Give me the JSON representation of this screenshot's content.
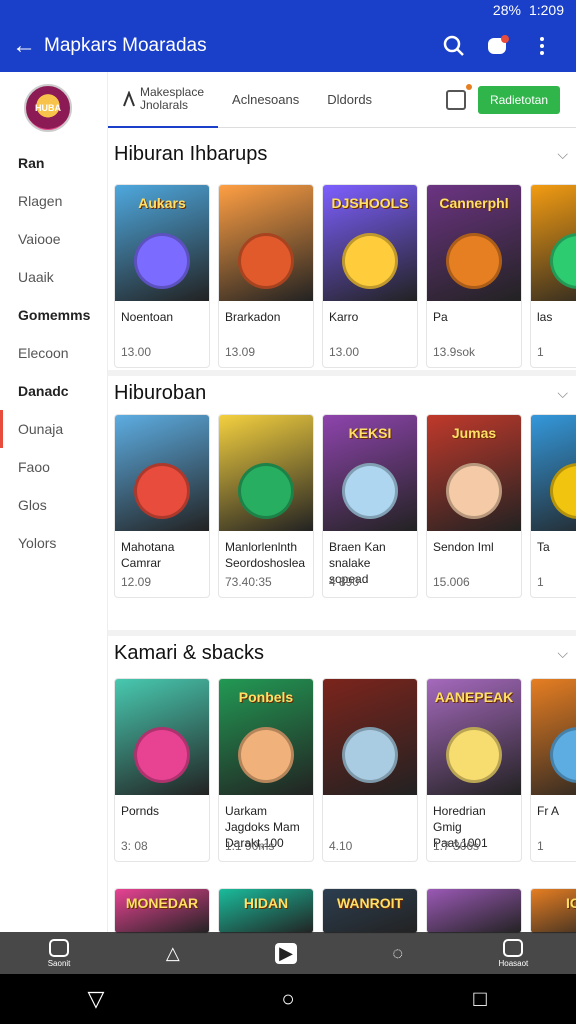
{
  "status": {
    "battery": "28%",
    "time": "1:209"
  },
  "appbar": {
    "title": "Mapkars Moaradas"
  },
  "sidebar": {
    "logo_text": "HUBA",
    "items": [
      {
        "label": "Ran",
        "bold": true
      },
      {
        "label": "Rlagen",
        "bold": false
      },
      {
        "label": "Vaiooe",
        "bold": false
      },
      {
        "label": "Uaaik",
        "bold": false
      },
      {
        "label": "Gomemms",
        "bold": true
      },
      {
        "label": "Elecoon",
        "bold": false
      },
      {
        "label": "Danadc",
        "bold": true
      },
      {
        "label": "Ounaja",
        "bold": false,
        "active": true
      },
      {
        "label": "Faoo",
        "bold": false
      },
      {
        "label": "Glos",
        "bold": false
      },
      {
        "label": "Yolors",
        "bold": false
      }
    ]
  },
  "tabs": {
    "main_line1": "Makesplace",
    "main_line2": "Jnolarals",
    "tab2": "Aclnesoans",
    "tab3": "Dldords",
    "install": "Radietotan"
  },
  "sections": [
    {
      "title": "Hiburan Ihbarups",
      "cards": [
        {
          "thumb": "Aukars",
          "name": "Noentoan",
          "price": "13.00",
          "bg": "#4ea8de",
          "face": "#7b6cff"
        },
        {
          "thumb": "",
          "name": "Brarkadon",
          "price": "13.09",
          "bg": "#ff9f43",
          "face": "#e05a2b"
        },
        {
          "thumb": "DJSHOOLS",
          "name": "Karro",
          "price": "13.00",
          "bg": "#7d5fff",
          "face": "#ffcd3c"
        },
        {
          "thumb": "Cannerphl",
          "name": "Pa",
          "price": "13.9sok",
          "bg": "#6c3483",
          "face": "#e67e22"
        },
        {
          "thumb": "",
          "name": "las",
          "price": "1",
          "bg": "#f39c12",
          "face": "#2ecc71"
        }
      ]
    },
    {
      "title": "Hiburoban",
      "cards": [
        {
          "thumb": "",
          "name": "Mahotana Camrar",
          "price": "12.09",
          "bg": "#5dade2",
          "face": "#e74c3c"
        },
        {
          "thumb": "",
          "name": "Manlorlenlnth Seordoshoslea",
          "price": "73.40:35",
          "bg": "#f4d03f",
          "face": "#27ae60"
        },
        {
          "thumb": "KEKSI",
          "name": "Braen Kan snalake sopead",
          "price": "4 890",
          "bg": "#8e44ad",
          "face": "#aed6f1"
        },
        {
          "thumb": "Jumas",
          "name": "Sendon Iml",
          "price": "15.006",
          "bg": "#c0392b",
          "face": "#f5cba7"
        },
        {
          "thumb": "",
          "name": "Ta",
          "price": "1",
          "bg": "#3498db",
          "face": "#f1c40f"
        }
      ]
    },
    {
      "title": "Kamari & sbacks",
      "cards": [
        {
          "thumb": "",
          "name": "Pornds",
          "price": "3: 08",
          "bg": "#48c9b0",
          "face": "#e84393"
        },
        {
          "thumb": "Ponbels",
          "name": "Uarkam Jagdoks Mam Darakt,100",
          "price": "1:1 90ms",
          "bg": "#229954",
          "face": "#f0b27a"
        },
        {
          "thumb": "",
          "name": "",
          "price": "4.10",
          "bg": "#7b241c",
          "face": "#a9cce3"
        },
        {
          "thumb": "AANEPEAK",
          "name": "Horedrian Gmig Paat,1001",
          "price": "1.7 306s",
          "bg": "#a569bd",
          "face": "#f7dc6f"
        },
        {
          "thumb": "",
          "name": "Fr A",
          "price": "1",
          "bg": "#e67e22",
          "face": "#5dade2"
        }
      ]
    }
  ],
  "row4_thumbs": [
    "MONEDAR",
    "HIDAN",
    "WANROIT",
    "",
    "ICA"
  ],
  "bottombar": {
    "left_label": "Saonit",
    "right_label": "Hoasaot"
  }
}
